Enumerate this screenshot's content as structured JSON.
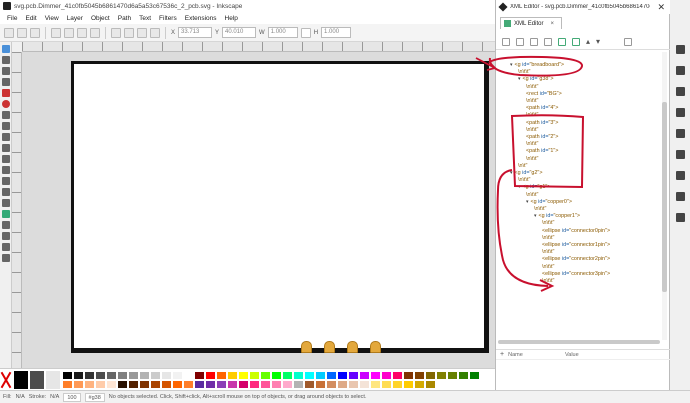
{
  "main_window": {
    "title": "svg.pcb.Dimmer_41c0fb5045b6861470d6a5a53c67536c_2_pcb.svg - Inkscape"
  },
  "menu": [
    "File",
    "Edit",
    "View",
    "Layer",
    "Object",
    "Path",
    "Text",
    "Filters",
    "Extensions",
    "Help"
  ],
  "tool_controls": {
    "x_label": "X",
    "x_value": "33.713",
    "y_label": "Y",
    "y_value": "40.010",
    "w_label": "W",
    "w_value": "1.000",
    "h_label": "H",
    "h_value": "1.000"
  },
  "xml_editor": {
    "window_title": "XML Editor - svg.pcb.Dimmer_41c0fb5045b6861470d6...",
    "tab_label": "XML Editor",
    "tab_close": "×",
    "close_glyph": "✕",
    "nodes": [
      {
        "depth": 1,
        "twisty": "▾",
        "tag": "<g",
        "attr": " id=",
        "val": "\"breadboard\">",
        "raw": ""
      },
      {
        "depth": 2,
        "twisty": "",
        "tag": "",
        "attr": "",
        "val": "",
        "raw": "\\n\\t\\t\""
      },
      {
        "depth": 2,
        "twisty": "▾",
        "tag": "<g",
        "attr": " id=",
        "val": "\"g38\">",
        "raw": ""
      },
      {
        "depth": 3,
        "twisty": "",
        "tag": "",
        "attr": "",
        "val": "",
        "raw": "\\n\\t\\t\""
      },
      {
        "depth": 3,
        "twisty": "",
        "tag": "<rect",
        "attr": " id=",
        "val": "\"BG\">",
        "raw": ""
      },
      {
        "depth": 3,
        "twisty": "",
        "tag": "",
        "attr": "",
        "val": "",
        "raw": "\\n\\t\\t\""
      },
      {
        "depth": 3,
        "twisty": "",
        "tag": "<path",
        "attr": " id=",
        "val": "\"4\">",
        "raw": ""
      },
      {
        "depth": 3,
        "twisty": "",
        "tag": "",
        "attr": "",
        "val": "",
        "raw": "\\n\\t\\t\""
      },
      {
        "depth": 3,
        "twisty": "",
        "tag": "<path",
        "attr": " id=",
        "val": "\"3\">",
        "raw": ""
      },
      {
        "depth": 3,
        "twisty": "",
        "tag": "",
        "attr": "",
        "val": "",
        "raw": "\\n\\t\\t\""
      },
      {
        "depth": 3,
        "twisty": "",
        "tag": "<path",
        "attr": " id=",
        "val": "\"2\">",
        "raw": ""
      },
      {
        "depth": 3,
        "twisty": "",
        "tag": "",
        "attr": "",
        "val": "",
        "raw": "\\n\\t\\t\""
      },
      {
        "depth": 3,
        "twisty": "",
        "tag": "<path",
        "attr": " id=",
        "val": "\"1\">",
        "raw": ""
      },
      {
        "depth": 3,
        "twisty": "",
        "tag": "",
        "attr": "",
        "val": "",
        "raw": "\\n\\t\\t\""
      },
      {
        "depth": 2,
        "twisty": "",
        "tag": "",
        "attr": "",
        "val": "",
        "raw": "\\n\\t\""
      },
      {
        "depth": 1,
        "twisty": "▾",
        "tag": "<g",
        "attr": " id=",
        "val": "\"g2\">",
        "raw": ""
      },
      {
        "depth": 2,
        "twisty": "",
        "tag": "",
        "attr": "",
        "val": "",
        "raw": "\\n\\t\\t\""
      },
      {
        "depth": 2,
        "twisty": "▾",
        "tag": "<g",
        "attr": " id=",
        "val": "\"g1\">",
        "raw": ""
      },
      {
        "depth": 3,
        "twisty": "",
        "tag": "",
        "attr": "",
        "val": "",
        "raw": "\\n\\t\\t\""
      },
      {
        "depth": 3,
        "twisty": "▾",
        "tag": "<g",
        "attr": " id=",
        "val": "\"copper0\">",
        "raw": ""
      },
      {
        "depth": 4,
        "twisty": "",
        "tag": "",
        "attr": "",
        "val": "",
        "raw": "\\n\\t\\t\""
      },
      {
        "depth": 4,
        "twisty": "▾",
        "tag": "<g",
        "attr": " id=",
        "val": "\"copper1\">",
        "raw": ""
      },
      {
        "depth": 5,
        "twisty": "",
        "tag": "",
        "attr": "",
        "val": "",
        "raw": "\\n\\t\\t\""
      },
      {
        "depth": 5,
        "twisty": "",
        "tag": "<ellipse",
        "attr": " id=",
        "val": "\"connector0pin\">",
        "raw": ""
      },
      {
        "depth": 5,
        "twisty": "",
        "tag": "",
        "attr": "",
        "val": "",
        "raw": "\\n\\t\\t\""
      },
      {
        "depth": 5,
        "twisty": "",
        "tag": "<ellipse",
        "attr": " id=",
        "val": "\"connector1pin\">",
        "raw": ""
      },
      {
        "depth": 5,
        "twisty": "",
        "tag": "",
        "attr": "",
        "val": "",
        "raw": "\\n\\t\\t\""
      },
      {
        "depth": 5,
        "twisty": "",
        "tag": "<ellipse",
        "attr": " id=",
        "val": "\"connector2pin\">",
        "raw": ""
      },
      {
        "depth": 5,
        "twisty": "",
        "tag": "",
        "attr": "",
        "val": "",
        "raw": "\\n\\t\\t\""
      },
      {
        "depth": 5,
        "twisty": "",
        "tag": "<ellipse",
        "attr": " id=",
        "val": "\"connector3pin\">",
        "raw": ""
      },
      {
        "depth": 5,
        "twisty": "",
        "tag": "",
        "attr": "",
        "val": "",
        "raw": "\\n\\t\\t\""
      }
    ],
    "attributes": {
      "add_glyph": "+",
      "name_header": "Name",
      "value_header": "Value"
    }
  },
  "statusbar": {
    "fill_label": "Fill:",
    "fill_value": "N/A",
    "stroke_label": "Stroke:",
    "stroke_value": "N/A",
    "opacity": "100",
    "layer": "#g38",
    "message": "No objects selected. Click, Shift+click, Alt+scroll mouse on top of objects, or drag around objects to select."
  },
  "palette": {
    "colors": [
      "#000000",
      "#1a1a1a",
      "#333333",
      "#4d4d4d",
      "#666666",
      "#808080",
      "#999999",
      "#b3b3b3",
      "#cccccc",
      "#e6e6e6",
      "#f2f2f2",
      "#ffffff",
      "#800000",
      "#ff0000",
      "#ff6600",
      "#ffcc00",
      "#ffff00",
      "#ccff00",
      "#66ff00",
      "#00ff00",
      "#00ff66",
      "#00ffcc",
      "#00ffff",
      "#00ccff",
      "#0066ff",
      "#0000ff",
      "#6600ff",
      "#cc00ff",
      "#ff00ff",
      "#ff00cc",
      "#ff0066",
      "#803300",
      "#804000",
      "#806600",
      "#808000",
      "#668000",
      "#338000",
      "#008000",
      "#ff7f2a",
      "#ff9955",
      "#ffb380",
      "#ffccaa",
      "#ffe6d5",
      "#2b1100",
      "#552200",
      "#803300",
      "#aa4400",
      "#d45500",
      "#ff6600",
      "#ff7f2a",
      "#5a2ca0",
      "#6f2da8",
      "#8b3fb7",
      "#c837ab",
      "#d4006b",
      "#ff2a7f",
      "#ff5599",
      "#ff80b2",
      "#ffaacc",
      "#b3b3b3",
      "#a05a2c",
      "#c87137",
      "#d38d5f",
      "#deaa87",
      "#e9c6af",
      "#f4e3d7",
      "#ffe680",
      "#ffdd55",
      "#ffd42a",
      "#ffcc00",
      "#d4aa00",
      "#aa8800"
    ]
  },
  "annotation_color": "#c8102e"
}
